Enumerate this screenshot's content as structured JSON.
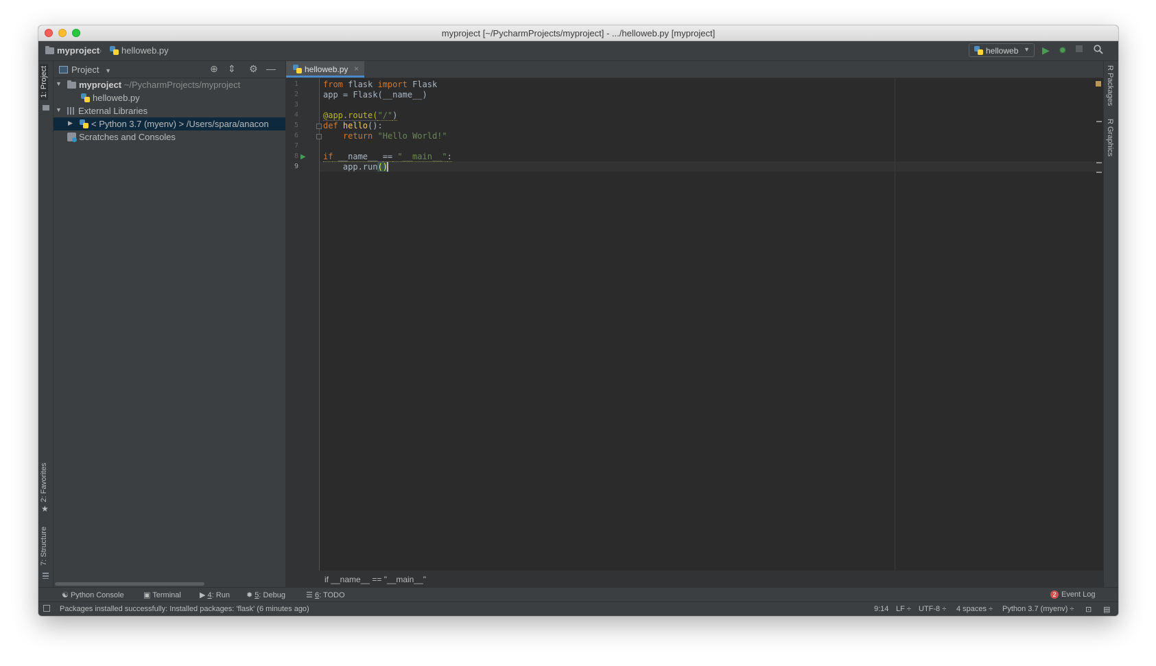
{
  "window": {
    "title": "myproject [~/PycharmProjects/myproject] - .../helloweb.py [myproject]"
  },
  "navbar": {
    "breadcrumb_project": "myproject",
    "breadcrumb_file": "helloweb.py",
    "run_config": "helloweb",
    "icons": [
      "run-icon",
      "debug-icon",
      "stop-icon",
      "search-icon"
    ]
  },
  "left_stripe": {
    "project_tab": "1: Project",
    "favorites_tab": "2: Favorites",
    "structure_tab": "7: Structure"
  },
  "right_stripe": {
    "packages_tab": "R Packages",
    "graphics_tab": "R Graphics"
  },
  "project_panel": {
    "title": "Project",
    "tree": [
      {
        "label": "myproject",
        "suffix": "~/PycharmProjects/myproject",
        "expanded": true
      },
      {
        "label": "helloweb.py"
      },
      {
        "label": "External Libraries",
        "expanded": true
      },
      {
        "label": "< Python 3.7 (myenv) >",
        "suffix": "/Users/spara/anacon",
        "selected": true
      },
      {
        "label": "Scratches and Consoles"
      }
    ]
  },
  "editor": {
    "tab_label": "helloweb.py",
    "close_glyph": "×",
    "line_numbers": [
      "1",
      "2",
      "3",
      "4",
      "5",
      "6",
      "7",
      "8",
      "9"
    ],
    "current_line": "9",
    "lines": {
      "l1_from": "from",
      "l1_mod": " flask ",
      "l1_import": "import",
      "l1_name": " Flask",
      "l2": "app = Flask(__name__)",
      "l4_deco": "@app.route(",
      "l4_str": "\"/\"",
      "l4_close": ")",
      "l5_def": "def",
      "l5_fn": " hello",
      "l5_rest": "():",
      "l6_indent": "    ",
      "l6_return": "return",
      "l6_str": " \"Hello World!\"",
      "l8_if": "if",
      "l8_name": " __name__ ",
      "l8_eq": "==",
      "l8_str": " \"__main__\"",
      "l8_colon": ":",
      "l9_indent": "    ",
      "l9_call": "app.run",
      "l9_open": "(",
      "l9_close": ")"
    },
    "bottom_breadcrumb": "if __name__ == \"__main__\""
  },
  "bottom_tools": {
    "python_console": "Python Console",
    "terminal": "Terminal",
    "run_num": "4",
    "run_label": ": Run",
    "debug_num": "5",
    "debug_label": ": Debug",
    "todo_num": "6",
    "todo_label": ": TODO",
    "event_log_count": "2",
    "event_log": "Event Log"
  },
  "status": {
    "message": "Packages installed successfully: Installed packages: 'flask' (6 minutes ago)",
    "position": "9:14",
    "line_sep": "LF ÷",
    "encoding": "UTF-8 ÷",
    "indent": "4 spaces ÷",
    "interpreter": "Python 3.7 (myenv) ÷"
  },
  "colors": {
    "accent": "#4a88c7",
    "keyword": "#cc7832",
    "string": "#6a8759",
    "decorator": "#bbb529",
    "function": "#ffc66d",
    "run_green": "#499c54"
  }
}
